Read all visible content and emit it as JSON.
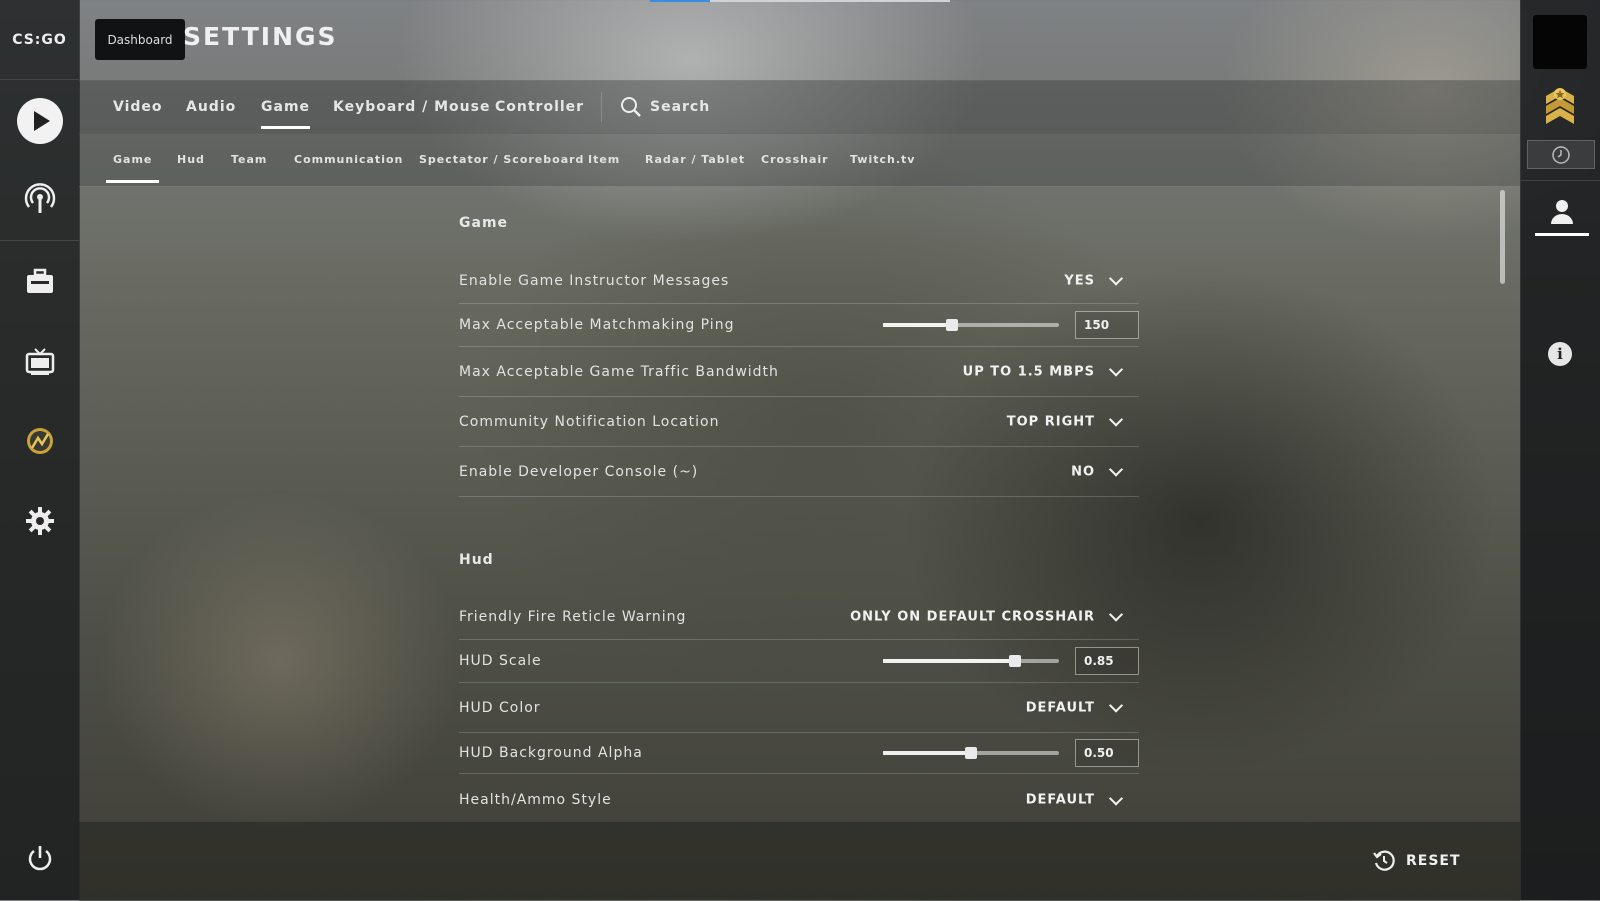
{
  "app": {
    "logo_text": "CS:GO",
    "tooltip": "Dashboard",
    "page_title": "SETTINGS",
    "progress_fraction": 0.2
  },
  "left_sidebar": {
    "items": [
      {
        "name": "play-icon"
      },
      {
        "name": "broadcast-icon"
      },
      {
        "name": "inventory-icon"
      },
      {
        "name": "watch-tv-icon"
      },
      {
        "name": "operation-icon"
      },
      {
        "name": "gear-icon"
      },
      {
        "name": "power-icon"
      }
    ]
  },
  "tabs": [
    {
      "label": "Video"
    },
    {
      "label": "Audio"
    },
    {
      "label": "Game",
      "active": true
    },
    {
      "label": "Keyboard / Mouse"
    },
    {
      "label": "Controller"
    }
  ],
  "search": {
    "label": "Search"
  },
  "subtabs": [
    {
      "label": "Game",
      "active": true
    },
    {
      "label": "Hud"
    },
    {
      "label": "Team"
    },
    {
      "label": "Communication"
    },
    {
      "label": "Spectator / Scoreboard"
    },
    {
      "label": "Item"
    },
    {
      "label": "Radar / Tablet"
    },
    {
      "label": "Crosshair"
    },
    {
      "label": "Twitch.tv"
    }
  ],
  "sections": {
    "game": {
      "title": "Game",
      "rows": [
        {
          "label": "Enable Game Instructor Messages",
          "value": "YES"
        },
        {
          "label": "Max Acceptable Matchmaking Ping",
          "value": "150",
          "slider_fraction": 0.39
        },
        {
          "label": "Max Acceptable Game Traffic Bandwidth",
          "value": "UP TO 1.5 MBPS"
        },
        {
          "label": "Community Notification Location",
          "value": "TOP RIGHT"
        },
        {
          "label": "Enable Developer Console (~)",
          "value": "NO"
        }
      ]
    },
    "hud": {
      "title": "Hud",
      "rows": [
        {
          "label": "Friendly Fire Reticle Warning",
          "value": "ONLY ON DEFAULT CROSSHAIR"
        },
        {
          "label": "HUD Scale",
          "value": "0.85",
          "slider_fraction": 0.75
        },
        {
          "label": "HUD Color",
          "value": "DEFAULT"
        },
        {
          "label": "HUD Background Alpha",
          "value": "0.50",
          "slider_fraction": 0.5
        },
        {
          "label": "Health/Ammo Style",
          "value": "DEFAULT"
        }
      ]
    }
  },
  "footer": {
    "reset_label": "RESET"
  },
  "right_sidebar": {
    "items": [
      {
        "name": "avatar"
      },
      {
        "name": "rank-icon"
      },
      {
        "name": "clock-icon"
      },
      {
        "name": "friends-icon"
      },
      {
        "name": "info-icon"
      }
    ]
  }
}
